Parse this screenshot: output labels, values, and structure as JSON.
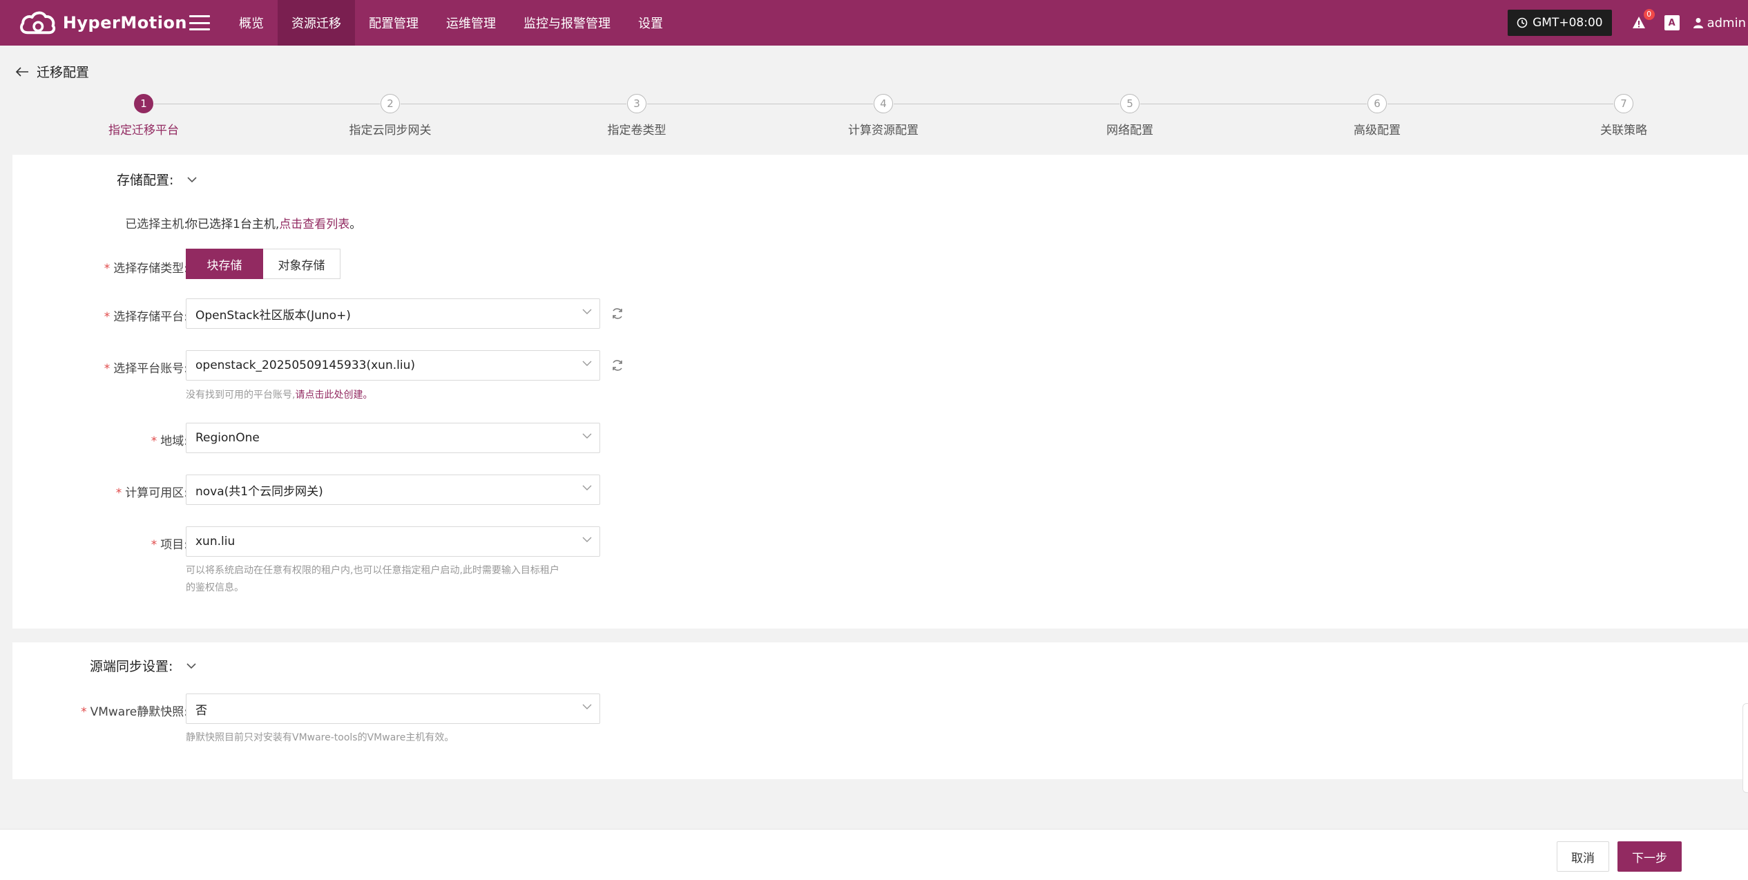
{
  "header": {
    "brand": "HyperMotion",
    "nav": [
      {
        "label": "概览",
        "active": false
      },
      {
        "label": "资源迁移",
        "active": true
      },
      {
        "label": "配置管理",
        "active": false
      },
      {
        "label": "运维管理",
        "active": false
      },
      {
        "label": "监控与报警管理",
        "active": false
      },
      {
        "label": "设置",
        "active": false
      }
    ],
    "timezone": "GMT+08:00",
    "alert_count": "0",
    "user": "admin",
    "accent_color": "#922a61"
  },
  "page": {
    "title": "迁移配置"
  },
  "steps": [
    {
      "num": "1",
      "label": "指定迁移平台",
      "active": true
    },
    {
      "num": "2",
      "label": "指定云同步网关",
      "active": false
    },
    {
      "num": "3",
      "label": "指定卷类型",
      "active": false
    },
    {
      "num": "4",
      "label": "计算资源配置",
      "active": false
    },
    {
      "num": "5",
      "label": "网络配置",
      "active": false
    },
    {
      "num": "6",
      "label": "高级配置",
      "active": false
    },
    {
      "num": "7",
      "label": "关联策略",
      "active": false
    }
  ],
  "storage": {
    "section_title": "存储配置:",
    "selected_hosts_label": "已选择主机:",
    "selected_hosts_text": "你已选择1台主机,",
    "selected_hosts_link": "点击查看列表",
    "selected_hosts_end": "。",
    "storage_type_label": "选择存储类型:",
    "storage_type_options": [
      "块存储",
      "对象存储"
    ],
    "storage_type_selected": "块存储",
    "platform_label": "选择存储平台:",
    "platform_value": "OpenStack社区版本(Juno+)",
    "account_label": "选择平台账号:",
    "account_value": "openstack_20250509145933(xun.liu)",
    "account_hint": "没有找到可用的平台账号,",
    "account_hint_link": "请点击此处创建。",
    "region_label": "地域:",
    "region_value": "RegionOne",
    "az_label": "计算可用区:",
    "az_value": "nova(共1个云同步网关)",
    "project_label": "项目:",
    "project_value": "xun.liu",
    "project_hint_1": "可以将系统启动在任意有权限的租户内,也可以任意指定租户启动,此时需要输入目标租户",
    "project_hint_2": "的鉴权信息。"
  },
  "source_sync": {
    "section_title": "源端同步设置:",
    "snapshot_label": "VMware静默快照:",
    "snapshot_value": "否",
    "snapshot_hint": "静默快照目前只对安装有VMware-tools的VMware主机有效。"
  },
  "footer": {
    "cancel": "取消",
    "next": "下一步"
  }
}
